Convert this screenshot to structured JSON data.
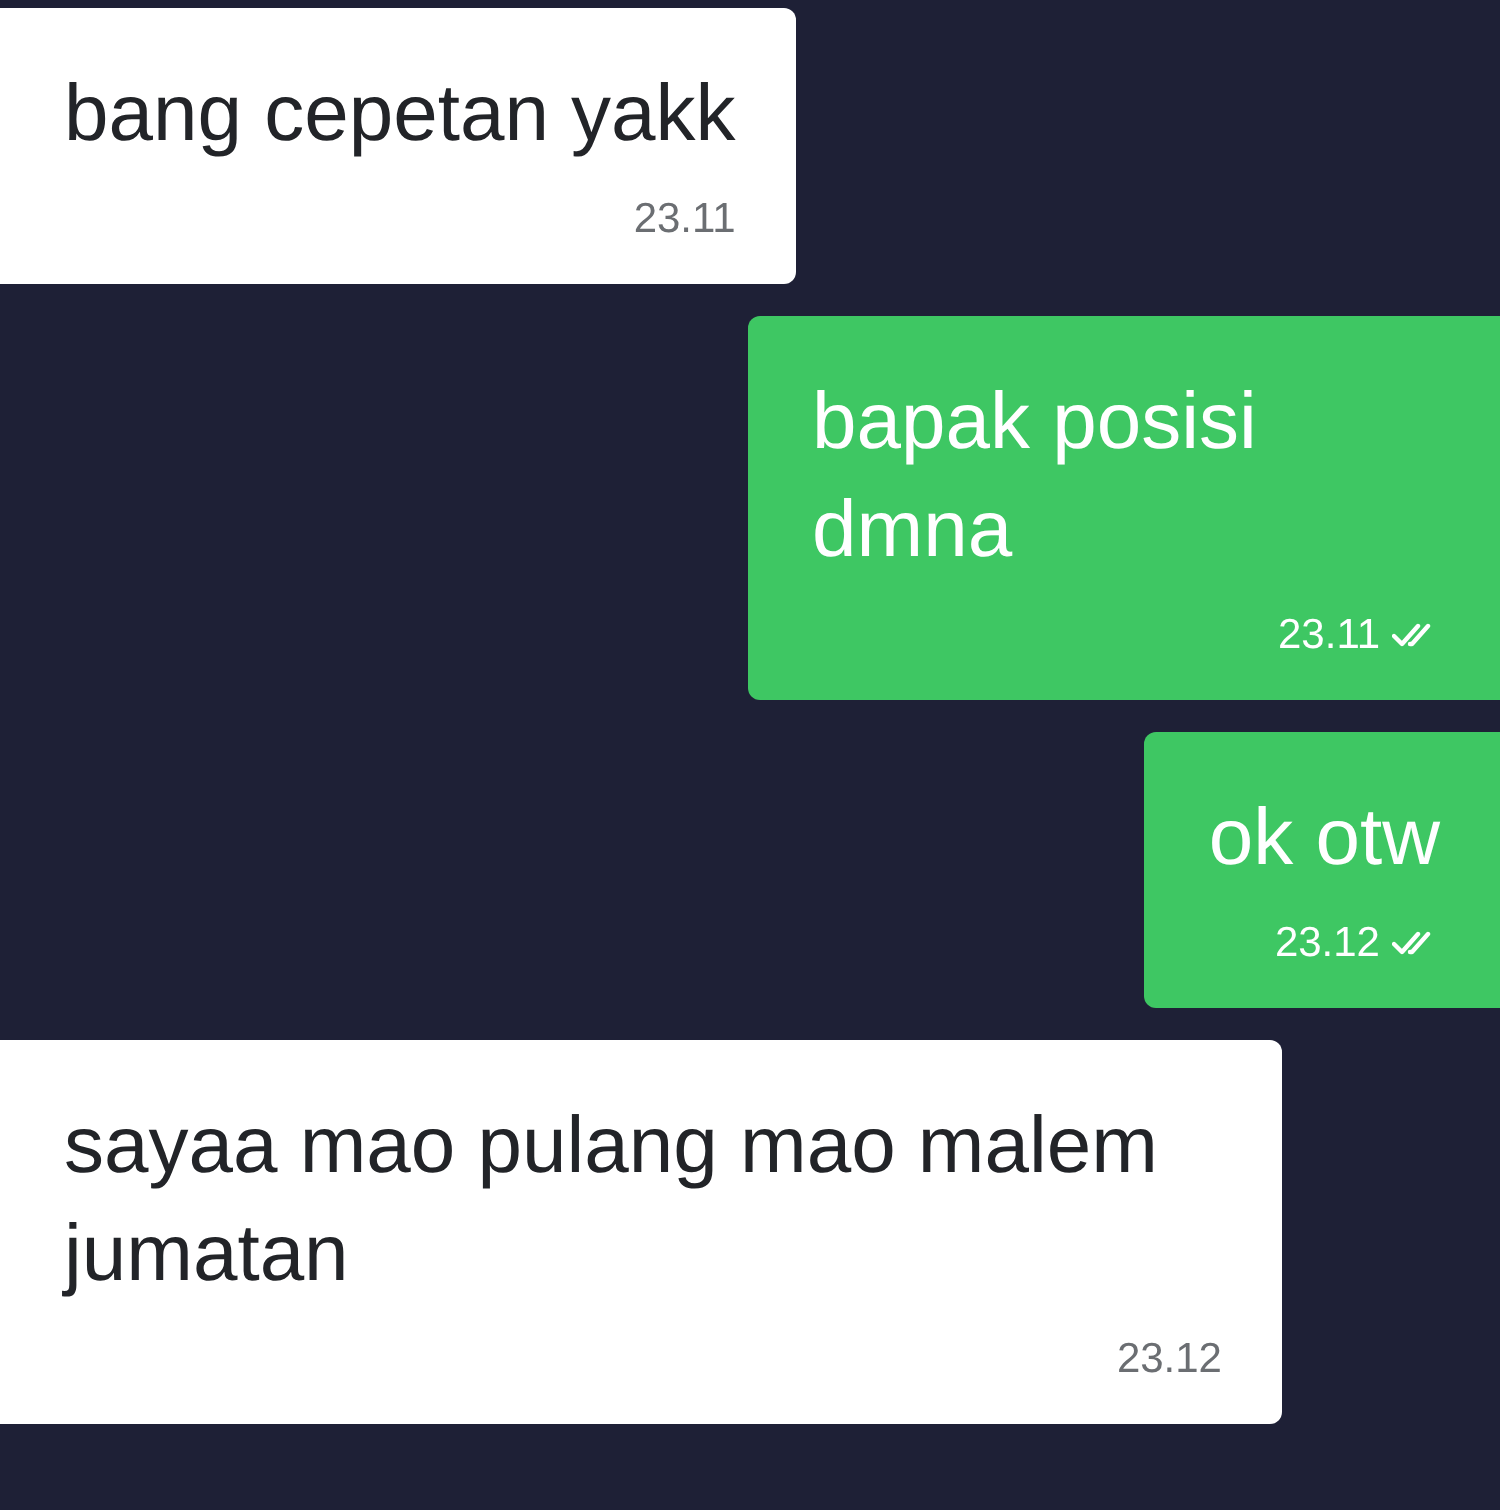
{
  "messages": [
    {
      "kind": "in",
      "text": "bang cepetan yakk",
      "time": "23.11"
    },
    {
      "kind": "out",
      "text": "bapak posisi dmna",
      "time": "23.11",
      "read": true
    },
    {
      "kind": "out",
      "text": "ok otw",
      "time": "23.12",
      "read": true
    },
    {
      "kind": "in",
      "text": "sayaa mao pulang mao malem jumatan",
      "time": "23.12"
    }
  ]
}
